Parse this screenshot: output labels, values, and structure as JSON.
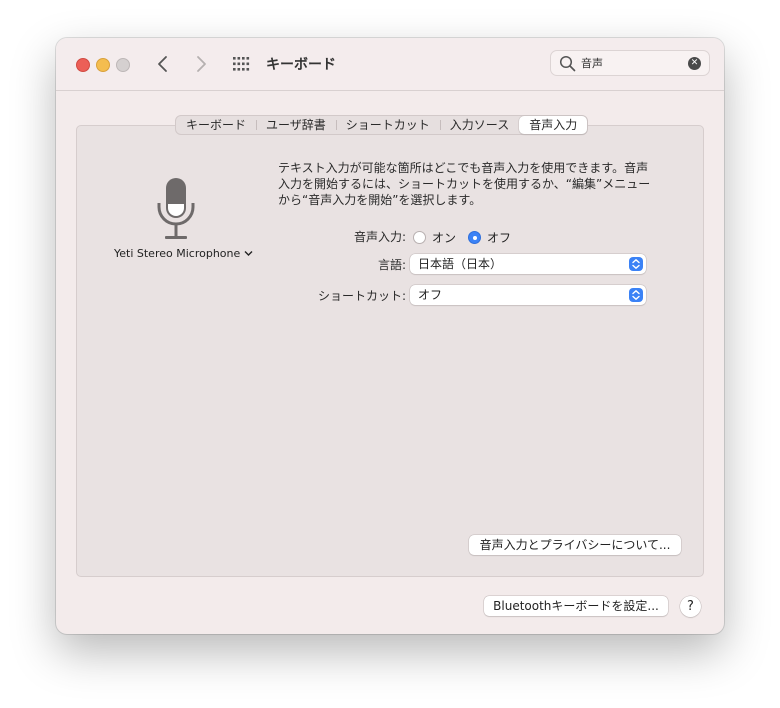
{
  "window": {
    "title": "キーボード"
  },
  "search": {
    "value": "音声"
  },
  "tabs": [
    {
      "label": "キーボード",
      "active": false
    },
    {
      "label": "ユーザ辞書",
      "active": false
    },
    {
      "label": "ショートカット",
      "active": false
    },
    {
      "label": "入力ソース",
      "active": false
    },
    {
      "label": "音声入力",
      "active": true
    }
  ],
  "dictation": {
    "device_name": "Yeti Stereo Microphone",
    "description": "テキスト入力が可能な箇所はどこでも音声入力を使用できます。音声入力を開始するには、ショートカットを使用するか、“編集”メニューから“音声入力を開始”を選択します。",
    "toggle_label": "音声入力:",
    "on_label": "オン",
    "off_label": "オフ",
    "selected": "off",
    "language_label": "言語:",
    "language_value": "日本語（日本）",
    "shortcut_label": "ショートカット:",
    "shortcut_value": "オフ",
    "privacy_button": "音声入力とプライバシーについて..."
  },
  "footer": {
    "bluetooth_button": "Bluetoothキーボードを設定...",
    "help_label": "?"
  },
  "colors": {
    "accent": "#3b82f6",
    "close": "#ec5f57",
    "minimize": "#f4bd4f"
  },
  "icons": [
    "close-icon",
    "minimize-icon",
    "zoom-icon",
    "back-chevron-icon",
    "forward-chevron-icon",
    "grid-icon",
    "search-icon",
    "clear-icon",
    "microphone-icon",
    "chevron-down-icon",
    "stepper-icon"
  ]
}
